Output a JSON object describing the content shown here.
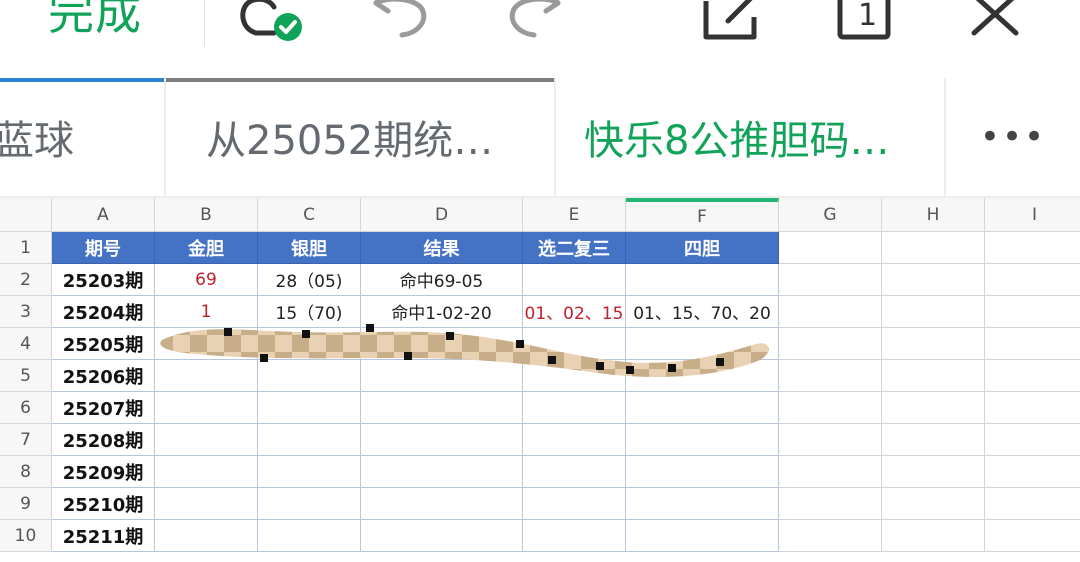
{
  "toolbar": {
    "done_label": "完成",
    "icons": [
      "cloud-saved-icon",
      "undo-icon",
      "redo-icon",
      "share-icon",
      "page-count-icon",
      "close-icon"
    ],
    "page_count": "1",
    "accent_color": "#12a35a"
  },
  "tabs": [
    {
      "label": "蓝球"
    },
    {
      "label": "从25052期统…"
    },
    {
      "label": "快乐8公推胆码…",
      "active": true
    }
  ],
  "tabs_more_label": "•••",
  "sheet": {
    "columns": [
      "A",
      "B",
      "C",
      "D",
      "E",
      "F",
      "G",
      "H",
      "I"
    ],
    "selected_column": "F",
    "rows": [
      "1",
      "2",
      "3",
      "4",
      "5",
      "6",
      "7",
      "8",
      "9",
      "10"
    ],
    "header": [
      "期号",
      "金胆",
      "银胆",
      "结果",
      "选二复三",
      "四胆"
    ],
    "data": [
      {
        "a": "25203期",
        "b": "69",
        "c": "28（05)",
        "d": "命中69-05",
        "e": "",
        "f": ""
      },
      {
        "a": "25204期",
        "b": "1",
        "c": "15（70)",
        "d": "命中1-02-20",
        "e": "01、02、15",
        "f": "01、15、70、20"
      },
      {
        "a": "25205期",
        "b": "",
        "c": "",
        "d": "",
        "e": "",
        "f": ""
      },
      {
        "a": "25206期",
        "b": "",
        "c": "",
        "d": "",
        "e": "",
        "f": ""
      },
      {
        "a": "25207期",
        "b": "",
        "c": "",
        "d": "",
        "e": "",
        "f": ""
      },
      {
        "a": "25208期",
        "b": "",
        "c": "",
        "d": "",
        "e": "",
        "f": ""
      },
      {
        "a": "25209期",
        "b": "",
        "c": "",
        "d": "",
        "e": "",
        "f": ""
      },
      {
        "a": "25210期",
        "b": "",
        "c": "",
        "d": "",
        "e": "",
        "f": ""
      },
      {
        "a": "25211期",
        "b": "",
        "c": "",
        "d": "",
        "e": "",
        "f": ""
      }
    ],
    "header_color": "#4472c4",
    "highlight_text_color": "#c0202a"
  }
}
